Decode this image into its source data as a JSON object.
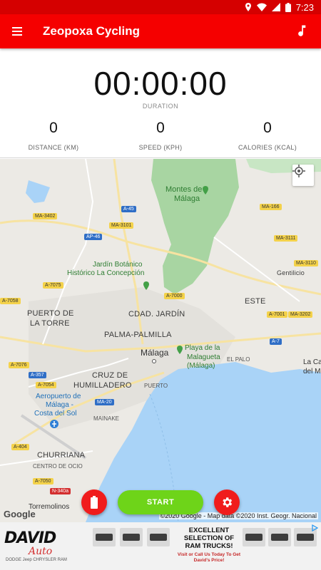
{
  "status_bar": {
    "time": "7:23"
  },
  "app_bar": {
    "title": "Zeopoxa Cycling"
  },
  "stats": {
    "duration_value": "00:00:00",
    "duration_label": "DURATION",
    "metrics": [
      {
        "value": "0",
        "label": "DISTANCE (KM)"
      },
      {
        "value": "0",
        "label": "SPEED (KPH)"
      },
      {
        "value": "0",
        "label": "CALORIES (KCAL)"
      }
    ]
  },
  "map": {
    "places": {
      "montes": "Montes de",
      "montes2": "Málaga",
      "jardin": "Jardín Botánico",
      "jardin2": "Histórico La Concepción",
      "puerto_torre": "PUERTO DE",
      "puerto_torre2": "LA TORRE",
      "cdad_jardin": "CDAD. JARDÍN",
      "este": "ESTE",
      "palma": "PALMA-PALMILLA",
      "malaga": "Málaga",
      "playa": "Playa de la",
      "playa2": "Malagueta",
      "playa3": "(Málaga)",
      "el_palo": "EL PALO",
      "la_cal": "La Cal",
      "del_mo": "del Mo",
      "cruz": "CRUZ DE",
      "cruz2": "HUMILLADERO",
      "puerto": "PUERTO",
      "aeropuerto": "Aeropuerto de",
      "aeropuerto2": "Málaga -",
      "aeropuerto3": "Costa del Sol",
      "mainake": "MAINAKE",
      "churriana": "CHURRIANA",
      "centro_ocio": "CENTRO DE OCIO",
      "torremolinos": "Torremolinos",
      "gentilicio": "Gentilicio"
    },
    "roads": {
      "ma3402": "MA-3402",
      "a45": "A-45",
      "ma3101": "MA-3101",
      "ap46": "AP-46",
      "ma166": "MA-166",
      "ma3111": "MA-3111",
      "ma3110": "MA-3110",
      "a7075": "A-7075",
      "a7058": "A-7058",
      "a7000": "A-7000",
      "a7001": "A-7001",
      "ma3202": "MA-3202",
      "a7": "A-7",
      "a7076": "A-7076",
      "a357": "A-357",
      "a7054": "A-7054",
      "ma20": "MA-20",
      "a404": "A-404",
      "a7050": "A-7050",
      "n340a": "N-340a"
    },
    "google_logo": "Google",
    "attribution": "©2020 Google - Map data ©2020 Inst. Geogr. Nacional"
  },
  "controls": {
    "start_label": "START"
  },
  "ad": {
    "logo": "DAVID",
    "logo_sub": "Auto",
    "brands": "DODGE  Jeep  CHRYSLER  RAM",
    "headline": "EXCELLENT SELECTION OF RAM TRUCKS!",
    "cta": "Visit or Call Us Today To Get David's Price!"
  },
  "colors": {
    "app_bar": "#f50000",
    "status_bar": "#d50000",
    "start_button": "#6ed419",
    "fab_red": "#f01c1c",
    "sea": "#a9d3f7",
    "park": "#a8d5a2"
  }
}
